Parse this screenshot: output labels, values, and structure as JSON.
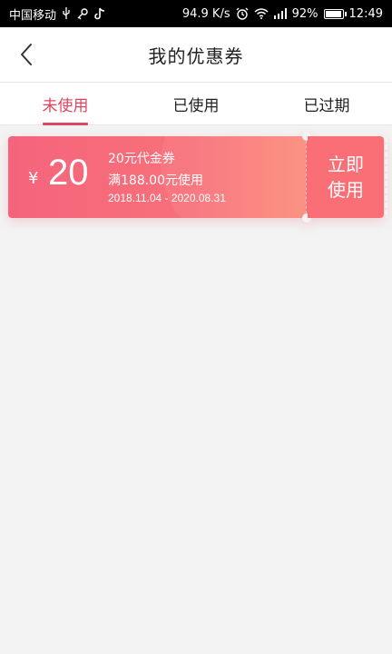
{
  "status_bar": {
    "carrier": "中国移动",
    "speed": "94.9 K/s",
    "battery": "92%",
    "time": "12:49"
  },
  "header": {
    "title": "我的优惠券"
  },
  "tabs": [
    {
      "label": "未使用",
      "active": true
    },
    {
      "label": "已使用",
      "active": false
    },
    {
      "label": "已过期",
      "active": false
    }
  ],
  "coupon": {
    "currency": "¥",
    "amount": "20",
    "name": "20元代金券",
    "condition": "满188.00元使用",
    "date_range": "2018.11.04 - 2020.08.31",
    "action_label": "立即使用"
  },
  "colors": {
    "accent": "#e0445e",
    "coupon_start": "#f5647c",
    "coupon_end": "#fb8c7c",
    "page_bg": "#f3f3f3"
  }
}
